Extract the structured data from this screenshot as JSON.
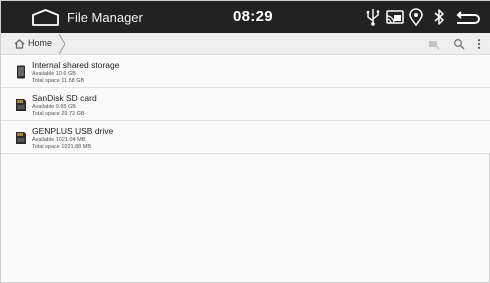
{
  "statusbar": {
    "app_title": "File Manager",
    "time": "08:29",
    "icons": [
      "home-outline-icon",
      "usb-icon",
      "cast-icon",
      "location-icon",
      "bluetooth-icon",
      "back-arrow-icon"
    ]
  },
  "toolbar": {
    "breadcrumb_home": "Home",
    "icons": [
      "select-icon",
      "search-icon",
      "more-vert-icon"
    ]
  },
  "storage": [
    {
      "name": "Internal shared storage",
      "available": "Available 10.6 GB",
      "total": "Total space 11.58 GB",
      "icon": "phone-storage-icon"
    },
    {
      "name": "SanDisk SD card",
      "available": "Available 9.65 GB",
      "total": "Total space 29.72 GB",
      "icon": "sd-card-icon"
    },
    {
      "name": "GENPLUS USB drive",
      "available": "Available 1021.04 MB",
      "total": "Total space 1021.88 MB",
      "icon": "usb-drive-icon"
    }
  ],
  "colors": {
    "statusbar_bg": "#222222",
    "toolbar_bg": "#eeeeee",
    "list_bg": "#fafafa",
    "divider": "#e2e2e2"
  }
}
